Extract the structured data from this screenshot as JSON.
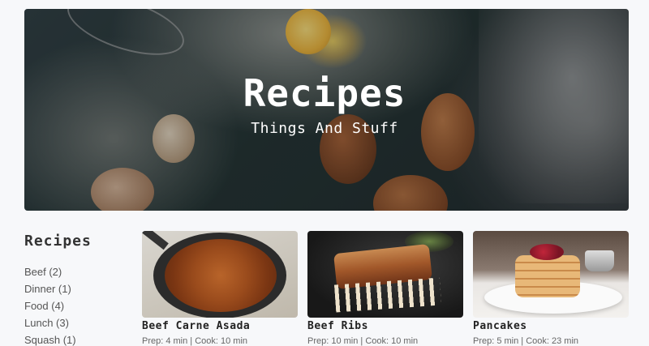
{
  "hero": {
    "title": "Recipes",
    "subtitle": "Things And Stuff"
  },
  "sidebar": {
    "title": "Recipes",
    "categories": [
      {
        "label": "Beef (2)"
      },
      {
        "label": "Dinner (1)"
      },
      {
        "label": "Food (4)"
      },
      {
        "label": "Lunch (3)"
      },
      {
        "label": "Squash (1)"
      }
    ]
  },
  "cards": [
    {
      "name": "Beef Carne Asada",
      "meta": "Prep: 4 min | Cook: 10 min",
      "photo_icon": "carne-asada-photo"
    },
    {
      "name": "Beef Ribs",
      "meta": "Prep: 10 min | Cook: 10 min",
      "photo_icon": "beef-ribs-photo"
    },
    {
      "name": "Pancakes",
      "meta": "Prep: 5 min | Cook: 23 min",
      "photo_icon": "pancakes-photo"
    }
  ],
  "colors": {
    "page_background": "#f7f8fa",
    "hero_text": "#ffffff",
    "heading_text": "#222222",
    "body_text": "#555555"
  }
}
